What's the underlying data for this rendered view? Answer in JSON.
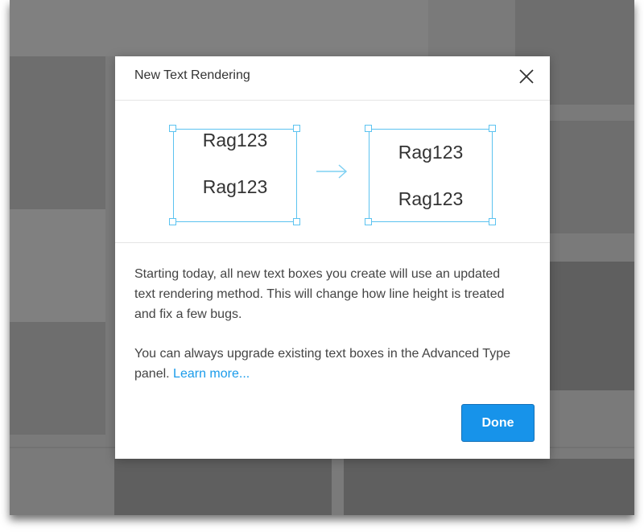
{
  "dialog": {
    "title": "New Text Rendering",
    "before_lines": [
      "Rag123",
      "Rag123"
    ],
    "after_lines": [
      "Rag123",
      "Rag123"
    ],
    "paragraph1": "Starting today, all new text boxes you create will use an updated text rendering method. This will change how line height is treated and fix a few bugs.",
    "paragraph2": "You can always upgrade existing text boxes in the Advanced Type panel.",
    "learn_more": "Learn more...",
    "done_label": "Done"
  },
  "colors": {
    "accent": "#1793ea",
    "selection": "#5cc3f0",
    "overlay": "#7a7a7a"
  },
  "icons": [
    "close-icon",
    "arrow-right-icon"
  ]
}
